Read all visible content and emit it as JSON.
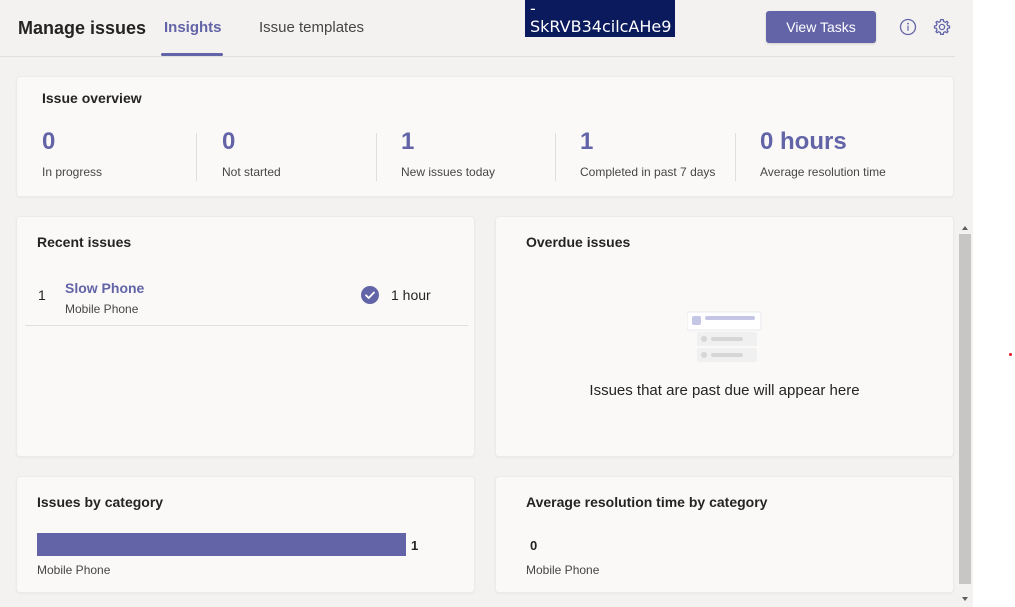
{
  "header": {
    "title": "Manage issues",
    "tabs": [
      {
        "label": "Insights",
        "active": true
      },
      {
        "label": "Issue templates",
        "active": false
      }
    ],
    "overlay_text": "-\nSkRVB34cilcAHe9",
    "view_tasks_label": "View Tasks",
    "info_icon": "info-icon",
    "settings_icon": "gear-icon",
    "accent_color": "#6264a7"
  },
  "overview": {
    "title": "Issue overview",
    "stats": [
      {
        "value": "0",
        "label": "In progress"
      },
      {
        "value": "0",
        "label": "Not started"
      },
      {
        "value": "1",
        "label": "New issues today"
      },
      {
        "value": "1",
        "label": "Completed in past 7 days"
      },
      {
        "value": "0 hours",
        "label": "Average resolution time"
      }
    ]
  },
  "recent_issues": {
    "title": "Recent issues",
    "items": [
      {
        "number": "1",
        "title": "Slow Phone",
        "category": "Mobile Phone",
        "time": "1 hour",
        "status_icon": "check-circle-icon"
      }
    ]
  },
  "overdue_issues": {
    "title": "Overdue issues",
    "empty_message": "Issues that are past due will appear here",
    "empty_icon": "empty-list-illustration"
  },
  "issues_by_category": {
    "title": "Issues by category",
    "chart_data": {
      "type": "bar",
      "categories": [
        "Mobile Phone"
      ],
      "values": [
        1
      ]
    }
  },
  "avg_resolution_by_category": {
    "title": "Average resolution time by category",
    "chart_data": {
      "type": "bar",
      "categories": [
        "Mobile Phone"
      ],
      "values": [
        0
      ]
    }
  }
}
